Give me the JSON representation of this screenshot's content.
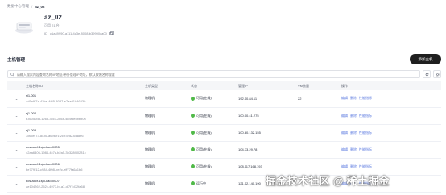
{
  "breadcrumb": {
    "parent": "数据中心管理",
    "separator": "/",
    "current": "az_02"
  },
  "zone": {
    "title": "az_02",
    "subtitle": "可用 21 台",
    "id_label": "ID",
    "id_value": "c1a49990-a111-4c3e-8008-b39990ca00"
  },
  "section": {
    "title": "主机管理",
    "action_label": "添加主机"
  },
  "search": {
    "placeholder": "请输入搜索内容查询名称/IP地址/带外管理IP地址，默认按照名称搜索"
  },
  "table": {
    "columns": [
      "",
      "主机名称/ID",
      "主机类型",
      "状态",
      "管理IP",
      "VM数量",
      "操作"
    ],
    "rows": [
      {
        "name": "sj1-001",
        "id": "4d5a9f7a-42be-4f65-8037-e7aad1846330",
        "type": "物理机",
        "status": "可用(在线)",
        "ip": "192.10.84.11",
        "vms": "22",
        "ops": [
          "编辑",
          "删除",
          "性能指标"
        ]
      },
      {
        "name": "sj1-002",
        "id": "b36050dd-1263-3cc3-2bca-4b4f3e5bb906",
        "type": "物理机",
        "status": "可用(在线)",
        "ip": "100.00.41.275",
        "vms": "",
        "ops": [
          "编辑",
          "删除",
          "性能指标"
        ]
      },
      {
        "name": "sj1-003",
        "id": "3d65f973-8c36-a696-f1f2c-f3ed23da8ff6",
        "type": "物理机",
        "status": "可用(在线)",
        "ip": "100.80.132.155",
        "vms": "",
        "ops": [
          "编辑",
          "删除",
          "性能指标"
        ]
      },
      {
        "name": "ecs-adcf-1sjo-kao-0005",
        "id": "42aa6406-1984-4c7c-b2a5-3b328f80281c",
        "type": "物理机",
        "status": "可用(在线)",
        "ip": "104.73.29.78",
        "vms": "",
        "ops": [
          "编辑",
          "删除",
          "性能指标"
        ]
      },
      {
        "name": "ecs-adcf-1sjo-kao-0006",
        "id": "be779f12-c984-4f08-be2c-eff77fa6a1b5",
        "type": "物理机",
        "status": "可用(在线)",
        "ip": "108.117.168.193",
        "vms": "",
        "ops": [
          "编辑",
          "删除",
          "性能指标"
        ]
      },
      {
        "name": "ecs-adcf-1sjo-kao-0007",
        "id": "ae104262-252c-4977-b1a7-df7f7d72fa68",
        "type": "物理机",
        "status": "运行中",
        "ip": "121.12.140.190",
        "vms": "",
        "ops": [
          "编辑",
          "删除",
          "性能指标"
        ]
      }
    ]
  },
  "watermark": "掘金技术社区 @ 稀土掘金"
}
